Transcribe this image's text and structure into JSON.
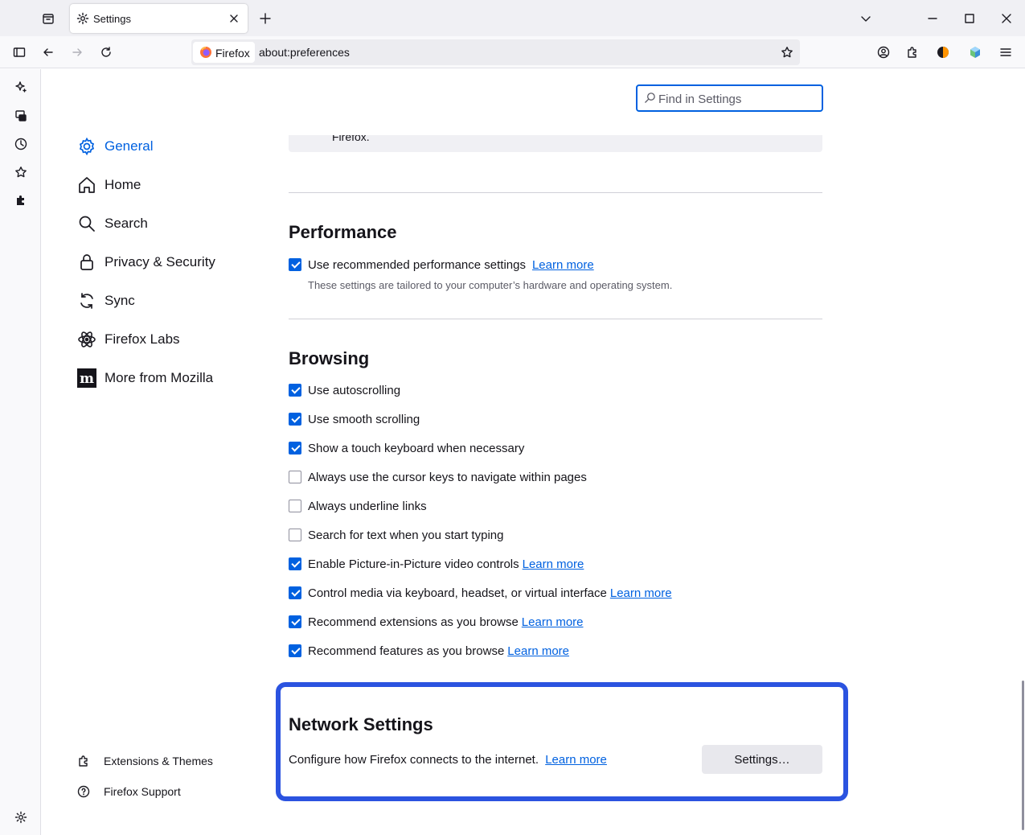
{
  "window": {
    "tab_title": "Settings",
    "controls": {
      "minimize": "minimize-icon",
      "maximize": "maximize-icon",
      "close": "close-icon"
    }
  },
  "navbar": {
    "identity_label": "Firefox",
    "url": "about:preferences"
  },
  "search": {
    "placeholder": "Find in Settings"
  },
  "categories": [
    {
      "label": "General",
      "icon": "gear-icon",
      "active": true
    },
    {
      "label": "Home",
      "icon": "home-icon"
    },
    {
      "label": "Search",
      "icon": "search-icon"
    },
    {
      "label": "Privacy & Security",
      "icon": "lock-icon"
    },
    {
      "label": "Sync",
      "icon": "sync-icon"
    },
    {
      "label": "Firefox Labs",
      "icon": "labs-icon"
    },
    {
      "label": "More from Mozilla",
      "icon": "mozilla-icon"
    }
  ],
  "footer": {
    "extensions": "Extensions & Themes",
    "support": "Firefox Support"
  },
  "prev_section_tail": "Firefox.",
  "performance": {
    "heading": "Performance",
    "recommended": {
      "label": "Use recommended performance settings",
      "checked": true,
      "learn_more": "Learn more"
    },
    "description": "These settings are tailored to your computer’s hardware and operating system."
  },
  "browsing": {
    "heading": "Browsing",
    "options": [
      {
        "label": "Use autoscrolling",
        "checked": true
      },
      {
        "label": "Use smooth scrolling",
        "checked": true
      },
      {
        "label": "Show a touch keyboard when necessary",
        "checked": true
      },
      {
        "label": "Always use the cursor keys to navigate within pages",
        "checked": false
      },
      {
        "label": "Always underline links",
        "checked": false
      },
      {
        "label": "Search for text when you start typing",
        "checked": false
      },
      {
        "label": "Enable Picture-in-Picture video controls",
        "checked": true,
        "learn_more": "Learn more"
      },
      {
        "label": "Control media via keyboard, headset, or virtual interface",
        "checked": true,
        "learn_more": "Learn more"
      },
      {
        "label": "Recommend extensions as you browse",
        "checked": true,
        "learn_more": "Learn more"
      },
      {
        "label": "Recommend features as you browse",
        "checked": true,
        "learn_more": "Learn more"
      }
    ]
  },
  "network": {
    "heading": "Network Settings",
    "description": "Configure how Firefox connects to the internet.",
    "learn_more": "Learn more",
    "button": "Settings…"
  },
  "colors": {
    "accent": "#0061e0",
    "highlight": "#2b53e0"
  }
}
